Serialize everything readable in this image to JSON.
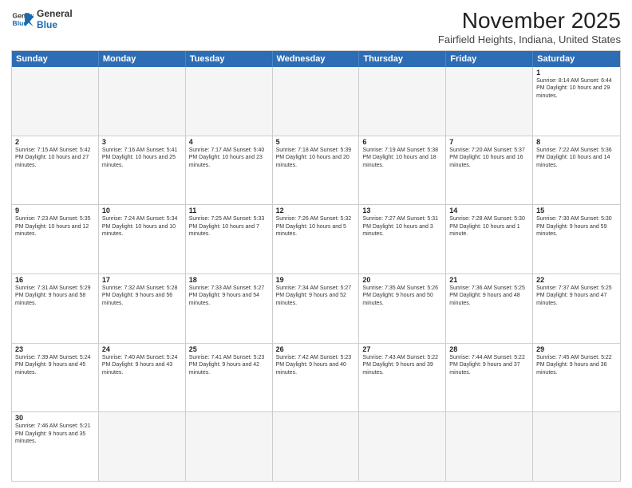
{
  "header": {
    "logo_general": "General",
    "logo_blue": "Blue",
    "title": "November 2025",
    "subtitle": "Fairfield Heights, Indiana, United States"
  },
  "day_headers": [
    "Sunday",
    "Monday",
    "Tuesday",
    "Wednesday",
    "Thursday",
    "Friday",
    "Saturday"
  ],
  "weeks": [
    [
      {
        "day": "",
        "empty": true,
        "info": ""
      },
      {
        "day": "",
        "empty": true,
        "info": ""
      },
      {
        "day": "",
        "empty": true,
        "info": ""
      },
      {
        "day": "",
        "empty": true,
        "info": ""
      },
      {
        "day": "",
        "empty": true,
        "info": ""
      },
      {
        "day": "",
        "empty": true,
        "info": ""
      },
      {
        "day": "1",
        "empty": false,
        "info": "Sunrise: 8:14 AM\nSunset: 6:44 PM\nDaylight: 10 hours\nand 29 minutes."
      }
    ],
    [
      {
        "day": "2",
        "empty": false,
        "info": "Sunrise: 7:15 AM\nSunset: 5:42 PM\nDaylight: 10 hours\nand 27 minutes."
      },
      {
        "day": "3",
        "empty": false,
        "info": "Sunrise: 7:16 AM\nSunset: 5:41 PM\nDaylight: 10 hours\nand 25 minutes."
      },
      {
        "day": "4",
        "empty": false,
        "info": "Sunrise: 7:17 AM\nSunset: 5:40 PM\nDaylight: 10 hours\nand 23 minutes."
      },
      {
        "day": "5",
        "empty": false,
        "info": "Sunrise: 7:18 AM\nSunset: 5:39 PM\nDaylight: 10 hours\nand 20 minutes."
      },
      {
        "day": "6",
        "empty": false,
        "info": "Sunrise: 7:19 AM\nSunset: 5:38 PM\nDaylight: 10 hours\nand 18 minutes."
      },
      {
        "day": "7",
        "empty": false,
        "info": "Sunrise: 7:20 AM\nSunset: 5:37 PM\nDaylight: 10 hours\nand 16 minutes."
      },
      {
        "day": "8",
        "empty": false,
        "info": "Sunrise: 7:22 AM\nSunset: 5:36 PM\nDaylight: 10 hours\nand 14 minutes."
      }
    ],
    [
      {
        "day": "9",
        "empty": false,
        "info": "Sunrise: 7:23 AM\nSunset: 5:35 PM\nDaylight: 10 hours\nand 12 minutes."
      },
      {
        "day": "10",
        "empty": false,
        "info": "Sunrise: 7:24 AM\nSunset: 5:34 PM\nDaylight: 10 hours\nand 10 minutes."
      },
      {
        "day": "11",
        "empty": false,
        "info": "Sunrise: 7:25 AM\nSunset: 5:33 PM\nDaylight: 10 hours\nand 7 minutes."
      },
      {
        "day": "12",
        "empty": false,
        "info": "Sunrise: 7:26 AM\nSunset: 5:32 PM\nDaylight: 10 hours\nand 5 minutes."
      },
      {
        "day": "13",
        "empty": false,
        "info": "Sunrise: 7:27 AM\nSunset: 5:31 PM\nDaylight: 10 hours\nand 3 minutes."
      },
      {
        "day": "14",
        "empty": false,
        "info": "Sunrise: 7:28 AM\nSunset: 5:30 PM\nDaylight: 10 hours\nand 1 minute."
      },
      {
        "day": "15",
        "empty": false,
        "info": "Sunrise: 7:30 AM\nSunset: 5:30 PM\nDaylight: 9 hours\nand 59 minutes."
      }
    ],
    [
      {
        "day": "16",
        "empty": false,
        "info": "Sunrise: 7:31 AM\nSunset: 5:29 PM\nDaylight: 9 hours\nand 58 minutes."
      },
      {
        "day": "17",
        "empty": false,
        "info": "Sunrise: 7:32 AM\nSunset: 5:28 PM\nDaylight: 9 hours\nand 56 minutes."
      },
      {
        "day": "18",
        "empty": false,
        "info": "Sunrise: 7:33 AM\nSunset: 5:27 PM\nDaylight: 9 hours\nand 54 minutes."
      },
      {
        "day": "19",
        "empty": false,
        "info": "Sunrise: 7:34 AM\nSunset: 5:27 PM\nDaylight: 9 hours\nand 52 minutes."
      },
      {
        "day": "20",
        "empty": false,
        "info": "Sunrise: 7:35 AM\nSunset: 5:26 PM\nDaylight: 9 hours\nand 50 minutes."
      },
      {
        "day": "21",
        "empty": false,
        "info": "Sunrise: 7:36 AM\nSunset: 5:25 PM\nDaylight: 9 hours\nand 48 minutes."
      },
      {
        "day": "22",
        "empty": false,
        "info": "Sunrise: 7:37 AM\nSunset: 5:25 PM\nDaylight: 9 hours\nand 47 minutes."
      }
    ],
    [
      {
        "day": "23",
        "empty": false,
        "info": "Sunrise: 7:39 AM\nSunset: 5:24 PM\nDaylight: 9 hours\nand 45 minutes."
      },
      {
        "day": "24",
        "empty": false,
        "info": "Sunrise: 7:40 AM\nSunset: 5:24 PM\nDaylight: 9 hours\nand 43 minutes."
      },
      {
        "day": "25",
        "empty": false,
        "info": "Sunrise: 7:41 AM\nSunset: 5:23 PM\nDaylight: 9 hours\nand 42 minutes."
      },
      {
        "day": "26",
        "empty": false,
        "info": "Sunrise: 7:42 AM\nSunset: 5:23 PM\nDaylight: 9 hours\nand 40 minutes."
      },
      {
        "day": "27",
        "empty": false,
        "info": "Sunrise: 7:43 AM\nSunset: 5:22 PM\nDaylight: 9 hours\nand 39 minutes."
      },
      {
        "day": "28",
        "empty": false,
        "info": "Sunrise: 7:44 AM\nSunset: 5:22 PM\nDaylight: 9 hours\nand 37 minutes."
      },
      {
        "day": "29",
        "empty": false,
        "info": "Sunrise: 7:45 AM\nSunset: 5:22 PM\nDaylight: 9 hours\nand 36 minutes."
      }
    ],
    [
      {
        "day": "30",
        "empty": false,
        "info": "Sunrise: 7:46 AM\nSunset: 5:21 PM\nDaylight: 9 hours\nand 35 minutes."
      },
      {
        "day": "",
        "empty": true,
        "info": ""
      },
      {
        "day": "",
        "empty": true,
        "info": ""
      },
      {
        "day": "",
        "empty": true,
        "info": ""
      },
      {
        "day": "",
        "empty": true,
        "info": ""
      },
      {
        "day": "",
        "empty": true,
        "info": ""
      },
      {
        "day": "",
        "empty": true,
        "info": ""
      }
    ]
  ]
}
